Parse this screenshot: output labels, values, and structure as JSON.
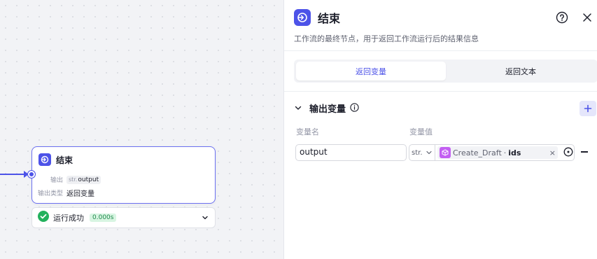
{
  "canvas": {
    "node": {
      "title": "结束",
      "output_label": "输出",
      "output_type": "str.",
      "output_name": "output",
      "output_kind_label": "输出类型",
      "output_kind_value": "返回变量"
    },
    "run": {
      "status": "运行成功",
      "duration": "0.000s"
    }
  },
  "panel": {
    "title": "结束",
    "description": "工作流的最终节点，用于返回工作流运行后的结果信息",
    "tabs": [
      {
        "label": "返回变量",
        "active": true
      },
      {
        "label": "返回文本",
        "active": false
      }
    ],
    "section": {
      "title": "输出变量",
      "col_name": "变量名",
      "col_value": "变量值"
    },
    "variable": {
      "name": "output",
      "type": "str.",
      "ref_source": "Create_Draft",
      "ref_sep": "·",
      "ref_field": "ids"
    }
  },
  "colors": {
    "accent": "#4d53e8",
    "success": "#1f8a4c",
    "ref_icon": "#c35ff2"
  }
}
